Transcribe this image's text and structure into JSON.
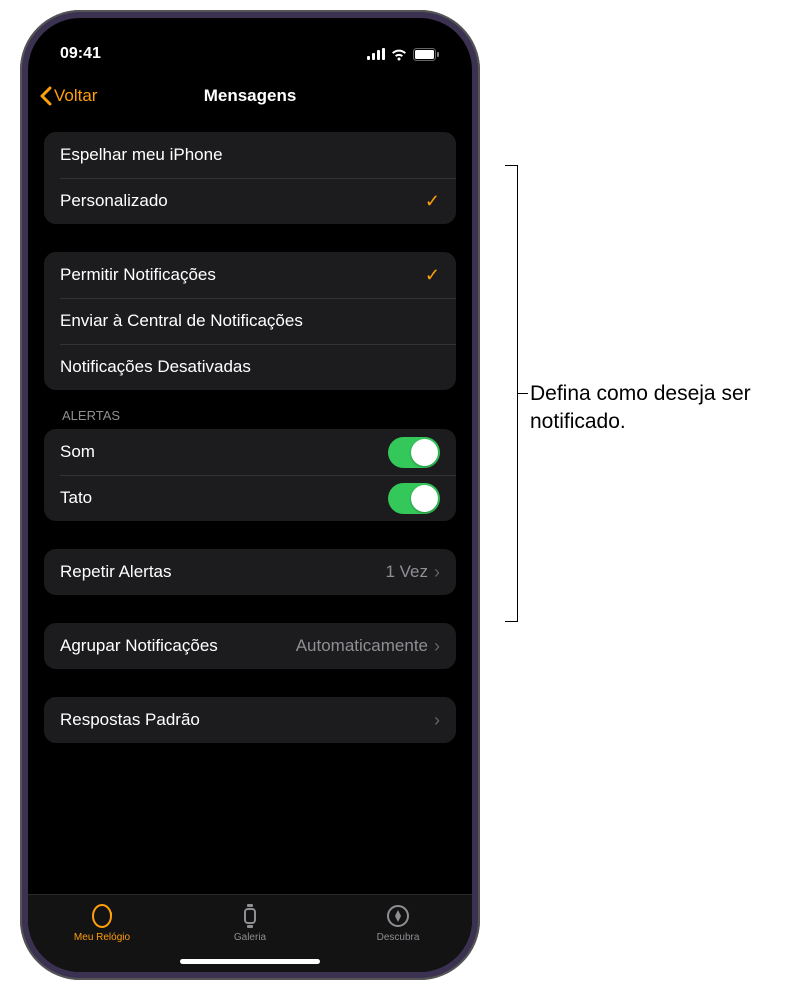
{
  "status": {
    "time": "09:41"
  },
  "nav": {
    "back": "Voltar",
    "title": "Mensagens"
  },
  "group1": {
    "mirror": "Espelhar meu iPhone",
    "custom": "Personalizado"
  },
  "group2": {
    "allow": "Permitir Notificações",
    "send": "Enviar à Central de Notificações",
    "off": "Notificações Desativadas"
  },
  "alerts": {
    "header": "Alertas",
    "sound": "Som",
    "haptic": "Tato"
  },
  "repeat": {
    "label": "Repetir Alertas",
    "value": "1 Vez"
  },
  "grouping": {
    "label": "Agrupar Notificações",
    "value": "Automaticamente"
  },
  "defaults": {
    "label": "Respostas Padrão"
  },
  "tabs": {
    "watch": "Meu Relógio",
    "gallery": "Galeria",
    "discover": "Descubra"
  },
  "callout": "Defina como deseja ser notificado."
}
